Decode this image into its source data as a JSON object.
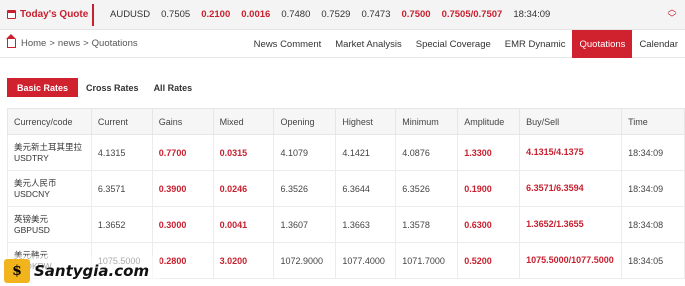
{
  "ticker": {
    "title": "Today's Quote",
    "symbol": "AUDUSD",
    "values": [
      {
        "text": "0.7505",
        "red": false
      },
      {
        "text": "0.2100",
        "red": true
      },
      {
        "text": "0.0016",
        "red": true
      },
      {
        "text": "0.7480",
        "red": false
      },
      {
        "text": "0.7529",
        "red": false
      },
      {
        "text": "0.7473",
        "red": false
      },
      {
        "text": "0.7500",
        "red": true
      },
      {
        "text": "0.7505/0.7507",
        "red": true
      },
      {
        "text": "18:34:09",
        "red": false
      }
    ],
    "arrow_up": "︿",
    "arrow_down": "﹀"
  },
  "breadcrumb": {
    "home": "Home",
    "sep": ">",
    "news": "news",
    "current": "Quotations"
  },
  "nav": [
    {
      "label": "News Comment",
      "active": false
    },
    {
      "label": "Market Analysis",
      "active": false
    },
    {
      "label": "Special Coverage",
      "active": false
    },
    {
      "label": "EMR Dynamic",
      "active": false
    },
    {
      "label": "Quotations",
      "active": true
    },
    {
      "label": "Calendar",
      "active": false
    }
  ],
  "tabs": [
    {
      "label": "Basic Rates",
      "active": true
    },
    {
      "label": "Cross Rates",
      "active": false
    },
    {
      "label": "All Rates",
      "active": false
    }
  ],
  "table": {
    "headers": [
      "Currency/code",
      "Current",
      "Gains",
      "Mixed",
      "Opening",
      "Highest",
      "Minimum",
      "Amplitude",
      "Buy/Sell",
      "Time"
    ],
    "rows": [
      {
        "cn": "美元新土耳其里拉",
        "code": "USDTRY",
        "current": "4.1315",
        "gains": "0.7700",
        "mixed": "0.0315",
        "opening": "4.1079",
        "highest": "4.1421",
        "minimum": "4.0876",
        "amplitude": "1.3300",
        "buysell": "4.1315/4.1375",
        "time": "18:34:09"
      },
      {
        "cn": "美元人民币",
        "code": "USDCNY",
        "current": "6.3571",
        "gains": "0.3900",
        "mixed": "0.0246",
        "opening": "6.3526",
        "highest": "6.3644",
        "minimum": "6.3526",
        "amplitude": "0.1900",
        "buysell": "6.3571/6.3594",
        "time": "18:34:09"
      },
      {
        "cn": "英镑美元",
        "code": "GBPUSD",
        "current": "1.3652",
        "gains": "0.3000",
        "mixed": "0.0041",
        "opening": "1.3607",
        "highest": "1.3663",
        "minimum": "1.3578",
        "amplitude": "0.6300",
        "buysell": "1.3652/1.3655",
        "time": "18:34:08"
      },
      {
        "cn": "美元韩元",
        "code": "USDKRW",
        "current": "1075.5000",
        "gains": "0.2800",
        "mixed": "3.0200",
        "opening": "1072.9000",
        "highest": "1077.4000",
        "minimum": "1071.7000",
        "amplitude": "0.5200",
        "buysell": "1075.5000/1077.5000",
        "time": "18:34:05"
      }
    ]
  },
  "watermark": {
    "logo_letter": "$",
    "text": "Santygia.com"
  }
}
